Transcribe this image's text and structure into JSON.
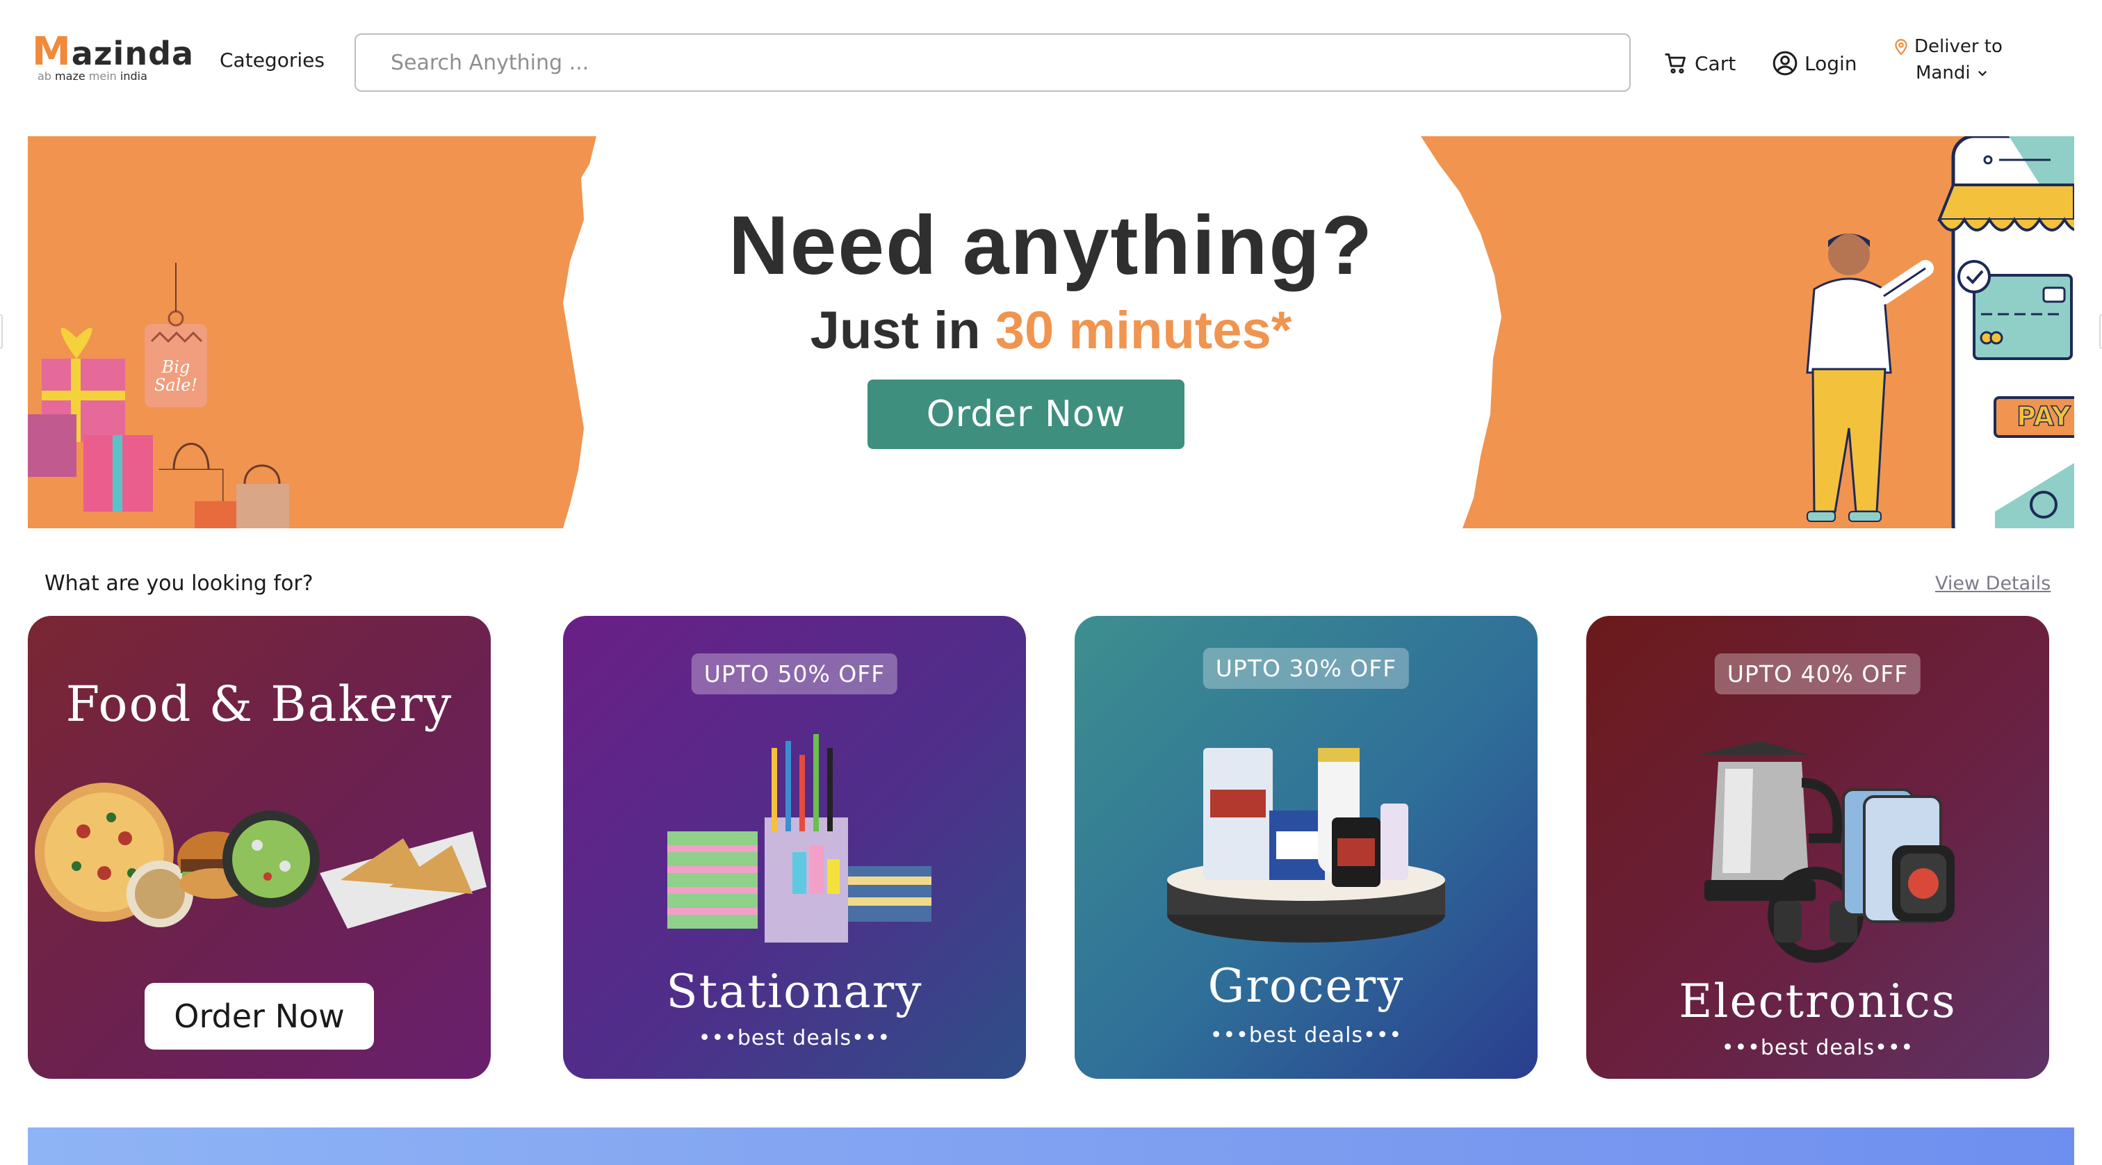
{
  "header": {
    "logo": {
      "wordmark": "Mazinda",
      "tagline_pre": "ab ",
      "tagline_maze": "maze",
      "tagline_mid": " mein ",
      "tagline_india": "india"
    },
    "categories_label": "Categories",
    "search_placeholder": "Search Anything ...",
    "search_value": "",
    "cart_label": "Cart",
    "login_label": "Login",
    "deliver_label": "Deliver to",
    "deliver_location": "Mandi"
  },
  "hero": {
    "title": "Need anything?",
    "subtitle_prefix": "Just in ",
    "subtitle_accent": "30 minutes*",
    "button_label": "Order Now",
    "tag_text": "Big Sale!",
    "pay_text": "PAY"
  },
  "section": {
    "title": "What are you looking for?",
    "view_details": "View Details"
  },
  "cards": [
    {
      "title": "Food & Bakery",
      "button_label": "Order Now"
    },
    {
      "badge": "UPTO 50% OFF",
      "title": "Stationary",
      "subtitle": "•••best deals•••"
    },
    {
      "badge": "UPTO 30% OFF",
      "title": "Grocery",
      "subtitle": "•••best deals•••"
    },
    {
      "badge": "UPTO 40% OFF",
      "title": "Electronics",
      "subtitle": "•••best deals•••"
    }
  ],
  "colors": {
    "brand_orange": "#f08a3a",
    "hero_orange": "#f0944f",
    "order_button": "#3f8f7e",
    "text_dark": "#2f2f2f"
  },
  "icons": [
    "cart-icon",
    "user-circle-icon",
    "location-pin-icon",
    "chevron-down-icon"
  ]
}
